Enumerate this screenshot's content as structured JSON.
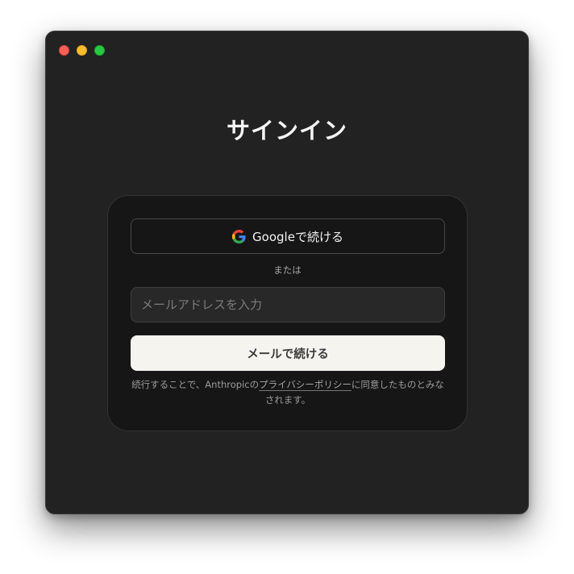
{
  "window": {
    "controls": [
      "close",
      "minimize",
      "zoom"
    ]
  },
  "page": {
    "title": "サインイン"
  },
  "signin": {
    "google_button_label": "Googleで続ける",
    "google_icon": "google-g-logo",
    "or_label": "または",
    "email_placeholder": "メールアドレスを入力",
    "email_value": "",
    "email_button_label": "メールで続ける",
    "legal_prefix": "続行することで、Anthropicの",
    "legal_link": "プライバシーポリシー",
    "legal_suffix": "に同意したものとみなされます。"
  },
  "colors": {
    "window_bg": "#222222",
    "card_bg": "#161616",
    "primary_button_bg": "#f6f4ef",
    "traffic_close": "#ff5f57",
    "traffic_minimize": "#febc2e",
    "traffic_zoom": "#28c840"
  }
}
